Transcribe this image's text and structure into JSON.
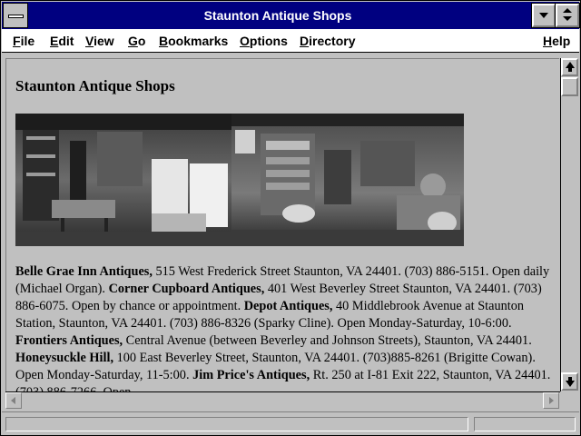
{
  "window": {
    "title": "Staunton Antique Shops"
  },
  "menu": {
    "items": [
      {
        "first": "F",
        "rest": "ile"
      },
      {
        "first": "E",
        "rest": "dit"
      },
      {
        "first": "V",
        "rest": "iew"
      },
      {
        "first": "G",
        "rest": "o"
      },
      {
        "first": "B",
        "rest": "ookmarks"
      },
      {
        "first": "O",
        "rest": "ptions"
      },
      {
        "first": "D",
        "rest": "irectory"
      },
      {
        "first": "H",
        "rest": "elp"
      }
    ]
  },
  "page": {
    "heading": "Staunton Antique Shops",
    "photo_alt": "Interior of antique shops",
    "entries": [
      {
        "name": "Belle Grae Inn Antiques,",
        "text": " 515 West Frederick Street Staunton, VA 24401. (703) 886-5151. Open daily (Michael Organ). "
      },
      {
        "name": "Corner Cupboard Antiques,",
        "text": " 401 West Beverley Street Staunton, VA 24401. (703) 886-6075. Open by chance or appointment. "
      },
      {
        "name": "Depot Antiques,",
        "text": " 40 Middlebrook Avenue at Staunton Station, Staunton, VA 24401. (703) 886-8326 (Sparky Cline). Open Monday-Saturday, 10-6:00. "
      },
      {
        "name": "Frontiers Antiques,",
        "text": " Central Avenue (between Beverley and Johnson Streets), Staunton, VA 24401. "
      },
      {
        "name": "Honeysuckle Hill,",
        "text": " 100 East Beverley Street, Staunton, VA 24401. (703)885-8261 (Brigitte Cowan). Open Monday-Saturday, 11-5:00. "
      },
      {
        "name": "Jim Price's Antiques,",
        "text": " Rt. 250 at I-81 Exit 222, Staunton, VA 24401. (703) 886-7266. Open"
      }
    ]
  },
  "status": {
    "text": ""
  }
}
